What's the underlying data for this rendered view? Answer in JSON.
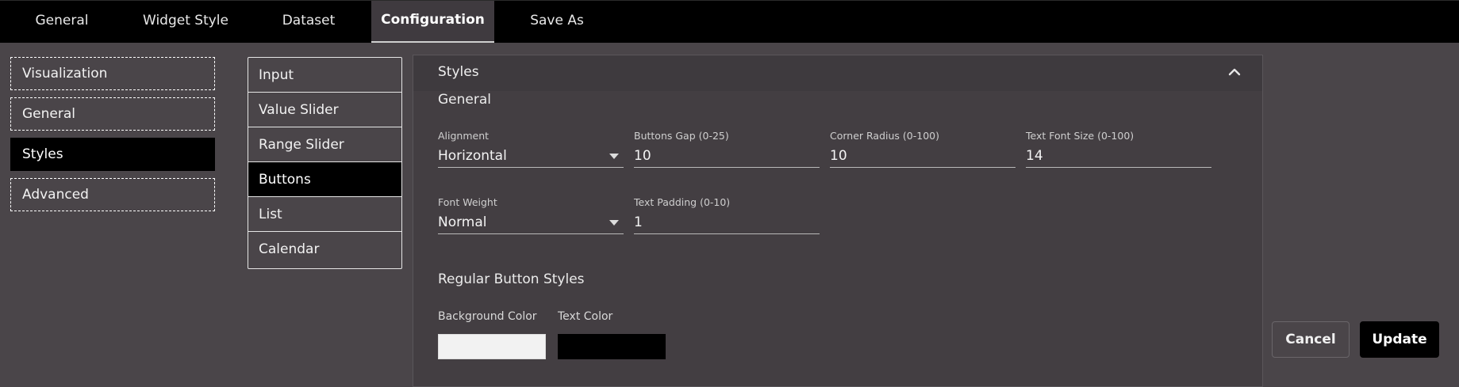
{
  "tabs": [
    {
      "label": "General",
      "active": false
    },
    {
      "label": "Widget Style",
      "active": false
    },
    {
      "label": "Dataset",
      "active": false
    },
    {
      "label": "Configuration",
      "active": true
    },
    {
      "label": "Save As",
      "active": false
    }
  ],
  "nav": [
    {
      "label": "Visualization",
      "active": false
    },
    {
      "label": "General",
      "active": false
    },
    {
      "label": "Styles",
      "active": true
    },
    {
      "label": "Advanced",
      "active": false
    }
  ],
  "sub_nav": [
    {
      "label": "Input",
      "active": false
    },
    {
      "label": "Value Slider",
      "active": false
    },
    {
      "label": "Range Slider",
      "active": false
    },
    {
      "label": "Buttons",
      "active": true
    },
    {
      "label": "List",
      "active": false
    },
    {
      "label": "Calendar",
      "active": false
    }
  ],
  "panel": {
    "title": "Styles",
    "collapse_icon": "chevron-up-icon",
    "section_general": "General",
    "fields_row1": [
      {
        "label": "Alignment",
        "value": "Horizontal",
        "type": "dropdown"
      },
      {
        "label": "Buttons Gap (0-25)",
        "value": "10",
        "type": "input"
      },
      {
        "label": "Corner Radius (0-100)",
        "value": "10",
        "type": "input"
      },
      {
        "label": "Text Font Size (0-100)",
        "value": "14",
        "type": "input"
      }
    ],
    "fields_row2": [
      {
        "label": "Font Weight",
        "value": "Normal",
        "type": "dropdown"
      },
      {
        "label": "Text Padding (0-10)",
        "value": "1",
        "type": "input"
      }
    ],
    "section_regular": "Regular Button Styles",
    "colors": [
      {
        "label": "Background Color",
        "value": "#f2f2f2"
      },
      {
        "label": "Text Color",
        "value": "#000000"
      }
    ]
  },
  "actions": {
    "cancel": "Cancel",
    "update": "Update"
  }
}
